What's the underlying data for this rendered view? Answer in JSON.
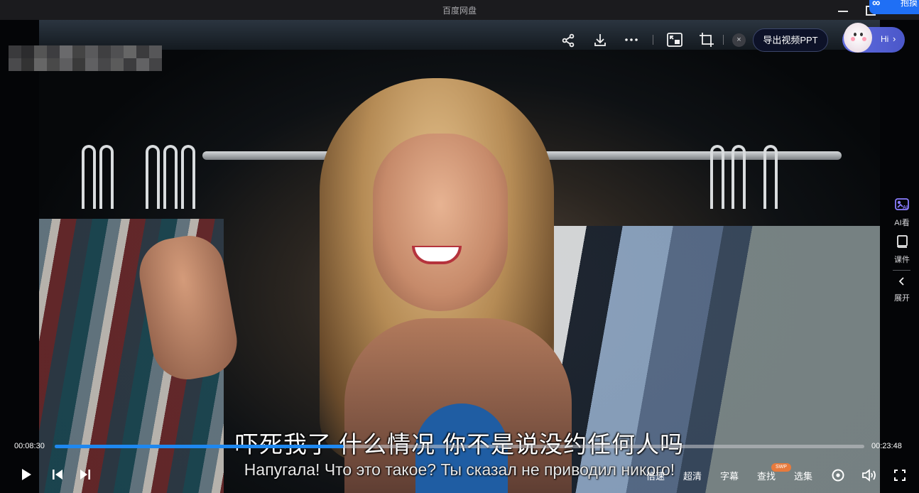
{
  "window": {
    "title": "百度网盘",
    "badge_text": "抱摸",
    "badge_logo": "∞"
  },
  "header": {
    "ppt_close_label": "×",
    "export_ppt_label": "导出视频PPT",
    "hi_label": "Hi",
    "hi_arrow": "›"
  },
  "sidebar": {
    "items": [
      {
        "label": "AI看",
        "icon": "ai-view-icon"
      },
      {
        "label": "课件",
        "icon": "courseware-icon"
      },
      {
        "label": "展开",
        "icon": "chevron-left-icon"
      }
    ]
  },
  "subtitles": {
    "chinese": "吓死我了 什么情况 你不是说没约任何人吗",
    "russian": "Напугала! Что это такое? Ты сказал не приводил никого!"
  },
  "player": {
    "current_time": "00:08:30",
    "total_time": "00:23:48",
    "progress_fraction": 0.357,
    "accent_color": "#1e88f0",
    "controls": {
      "speed_label": "倍速",
      "quality_label": "超清",
      "subtitle_label": "字幕",
      "search_label": "查找",
      "search_badge": "SWP",
      "episodes_label": "选集"
    }
  }
}
